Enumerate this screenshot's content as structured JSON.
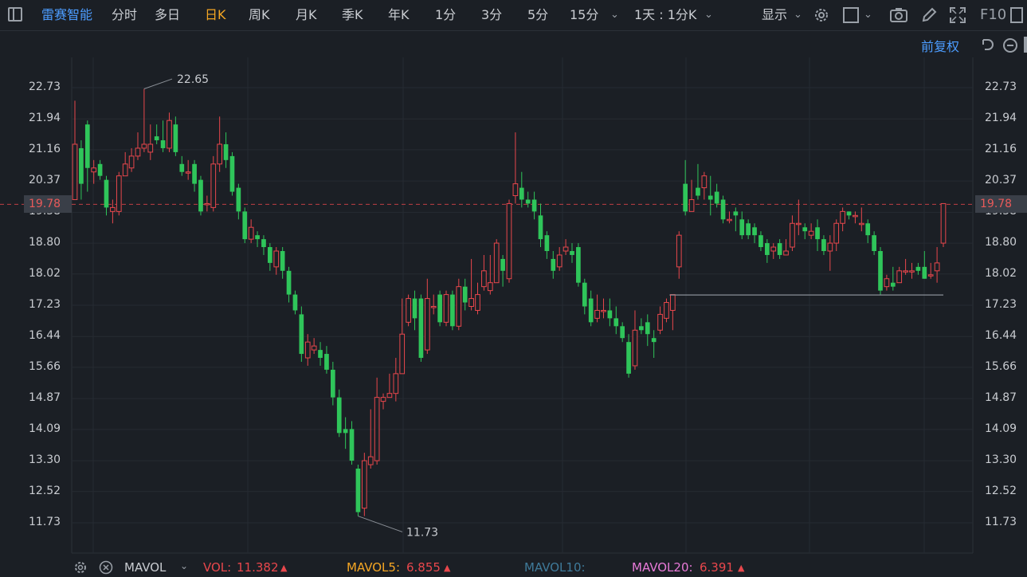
{
  "toolbar": {
    "stock_name": "雷赛智能",
    "tabs": [
      "分时",
      "多日",
      "日K",
      "周K",
      "月K",
      "季K",
      "年K",
      "1分",
      "3分",
      "5分",
      "15分"
    ],
    "active_tab": "日K",
    "period_select": "1天 : 1分K",
    "display_label": "显示",
    "f10_label": "F10"
  },
  "subbar": {
    "adjust_label": "前复权"
  },
  "axis": {
    "ticks": [
      "22.73",
      "21.94",
      "21.16",
      "20.37",
      "19.58",
      "18.80",
      "18.02",
      "17.23",
      "16.44",
      "15.66",
      "14.87",
      "14.09",
      "13.30",
      "12.52",
      "11.73"
    ],
    "current_price": "19.78"
  },
  "annotations": {
    "high_label": "22.65",
    "low_label": "11.73"
  },
  "bottom_bar": {
    "indicator": "MAVOL",
    "vol_label": "VOL:",
    "vol_value": "11.382",
    "mavol5_label": "MAVOL5:",
    "mavol5_value": "6.855",
    "mavol10_label": "MAVOL10:",
    "mavol20_label": "MAVOL20:",
    "mavol20_value": "6.391"
  },
  "colors": {
    "up": "#e8474c",
    "down": "#2fc55a",
    "accent": "#f5a623",
    "link": "#4c9cff",
    "mavol10": "#3f7a9a",
    "mavol20": "#e87ad8"
  },
  "chart_data": {
    "type": "candlestick",
    "y_ticks": [
      22.73,
      21.94,
      21.16,
      20.37,
      19.58,
      18.8,
      18.02,
      17.23,
      16.44,
      15.66,
      14.87,
      14.09,
      13.3,
      12.52,
      11.73
    ],
    "ylim": [
      11.45,
      23.05
    ],
    "current_price": 19.78,
    "high": 22.65,
    "low": 11.73,
    "candles": [
      [
        19.9,
        21.3,
        22.4,
        19.9
      ],
      [
        21.2,
        20.3,
        21.4,
        19.9
      ],
      [
        21.8,
        20.7,
        21.9,
        20.1
      ],
      [
        20.6,
        20.7,
        20.9,
        20.3
      ],
      [
        20.8,
        20.5,
        20.9,
        20.4
      ],
      [
        20.4,
        19.7,
        20.5,
        19.5
      ],
      [
        19.6,
        19.7,
        19.9,
        19.3
      ],
      [
        19.6,
        20.5,
        20.6,
        19.5
      ],
      [
        20.5,
        20.8,
        21.1,
        20.5
      ],
      [
        20.7,
        21.0,
        21.2,
        20.6
      ],
      [
        21.0,
        21.2,
        21.6,
        20.9
      ],
      [
        21.2,
        21.3,
        22.7,
        21.1
      ],
      [
        21.1,
        21.3,
        21.8,
        20.9
      ],
      [
        21.5,
        21.4,
        21.8,
        21.3
      ],
      [
        21.4,
        21.2,
        21.9,
        21.1
      ],
      [
        21.2,
        21.9,
        22.1,
        21.1
      ],
      [
        21.8,
        21.1,
        22.0,
        21.0
      ],
      [
        20.8,
        20.6,
        21.0,
        20.5
      ],
      [
        20.6,
        20.6,
        20.9,
        20.4
      ],
      [
        20.8,
        20.3,
        20.9,
        20.1
      ],
      [
        20.4,
        19.6,
        20.5,
        19.5
      ],
      [
        19.8,
        19.8,
        20.0,
        19.6
      ],
      [
        19.7,
        20.8,
        21.0,
        19.6
      ],
      [
        20.8,
        21.3,
        22.0,
        20.6
      ],
      [
        21.3,
        20.9,
        21.6,
        20.7
      ],
      [
        21.0,
        20.1,
        21.1,
        20.0
      ],
      [
        20.2,
        19.6,
        20.3,
        19.4
      ],
      [
        19.6,
        18.9,
        19.7,
        18.8
      ],
      [
        18.9,
        19.2,
        19.4,
        18.8
      ],
      [
        19.0,
        18.9,
        19.1,
        18.7
      ],
      [
        18.9,
        18.7,
        19.0,
        18.5
      ],
      [
        18.7,
        18.3,
        18.8,
        18.1
      ],
      [
        18.2,
        18.6,
        18.7,
        18.0
      ],
      [
        18.6,
        18.1,
        18.7,
        17.9
      ],
      [
        18.1,
        17.5,
        18.2,
        17.3
      ],
      [
        17.5,
        17.1,
        17.6,
        17.0
      ],
      [
        17.0,
        16.0,
        17.2,
        15.8
      ],
      [
        15.9,
        16.3,
        16.5,
        15.7
      ],
      [
        16.1,
        16.2,
        16.4,
        16.0
      ],
      [
        16.1,
        15.9,
        16.3,
        15.7
      ],
      [
        16.0,
        15.6,
        16.2,
        15.5
      ],
      [
        15.6,
        14.9,
        15.8,
        14.7
      ],
      [
        14.9,
        14.0,
        15.1,
        13.9
      ],
      [
        14.1,
        14.0,
        14.4,
        13.6
      ],
      [
        14.1,
        13.3,
        14.3,
        13.2
      ],
      [
        13.1,
        12.0,
        13.2,
        11.9
      ],
      [
        12.1,
        13.3,
        13.5,
        11.9
      ],
      [
        13.2,
        13.4,
        14.6,
        13.1
      ],
      [
        13.3,
        14.9,
        15.4,
        13.2
      ],
      [
        14.8,
        14.9,
        15.0,
        14.6
      ],
      [
        14.9,
        15.0,
        15.5,
        14.9
      ],
      [
        15.0,
        15.5,
        15.9,
        14.8
      ],
      [
        15.5,
        16.5,
        17.4,
        15.5
      ],
      [
        16.8,
        17.4,
        17.5,
        16.7
      ],
      [
        17.4,
        16.9,
        17.6,
        16.6
      ],
      [
        17.4,
        15.9,
        17.5,
        15.8
      ],
      [
        16.1,
        17.4,
        17.9,
        16.0
      ],
      [
        17.2,
        17.2,
        17.5,
        17.0
      ],
      [
        17.5,
        16.8,
        17.6,
        16.7
      ],
      [
        16.8,
        17.5,
        17.6,
        16.7
      ],
      [
        17.5,
        16.7,
        17.6,
        16.6
      ],
      [
        16.7,
        17.7,
        17.9,
        16.6
      ],
      [
        17.7,
        17.3,
        17.9,
        17.1
      ],
      [
        17.2,
        17.4,
        18.4,
        17.1
      ],
      [
        17.1,
        17.5,
        17.8,
        17.0
      ],
      [
        17.7,
        18.1,
        18.5,
        17.6
      ],
      [
        17.6,
        17.8,
        18.5,
        17.5
      ],
      [
        17.8,
        18.8,
        18.9,
        17.8
      ],
      [
        18.4,
        18.1,
        18.5,
        17.7
      ],
      [
        17.9,
        19.8,
        19.9,
        17.8
      ],
      [
        20.0,
        20.3,
        21.6,
        19.8
      ],
      [
        20.2,
        19.9,
        20.6,
        19.7
      ],
      [
        19.9,
        19.8,
        20.1,
        19.7
      ],
      [
        19.9,
        19.6,
        20.1,
        19.4
      ],
      [
        19.5,
        18.9,
        19.8,
        18.7
      ],
      [
        19.0,
        18.6,
        19.1,
        18.4
      ],
      [
        18.4,
        18.1,
        18.6,
        17.9
      ],
      [
        18.2,
        18.5,
        18.7,
        18.1
      ],
      [
        18.6,
        18.7,
        18.9,
        18.5
      ],
      [
        18.6,
        18.5,
        18.8,
        18.3
      ],
      [
        18.7,
        17.8,
        18.8,
        17.7
      ],
      [
        17.8,
        17.2,
        17.9,
        17.0
      ],
      [
        17.4,
        16.8,
        17.6,
        16.7
      ],
      [
        16.9,
        17.1,
        17.5,
        16.8
      ],
      [
        17.1,
        17.1,
        17.4,
        16.9
      ],
      [
        17.1,
        16.9,
        17.4,
        16.7
      ],
      [
        16.9,
        16.7,
        17.2,
        16.5
      ],
      [
        16.7,
        16.4,
        16.8,
        16.3
      ],
      [
        16.3,
        15.5,
        16.5,
        15.4
      ],
      [
        15.7,
        16.6,
        17.1,
        15.6
      ],
      [
        16.7,
        16.6,
        16.9,
        16.5
      ],
      [
        16.8,
        16.5,
        17.0,
        16.2
      ],
      [
        16.4,
        16.3,
        16.6,
        15.9
      ],
      [
        16.6,
        17.0,
        17.2,
        16.5
      ],
      [
        16.9,
        17.3,
        17.4,
        16.8
      ],
      [
        17.1,
        17.5,
        17.5,
        16.6
      ],
      [
        18.2,
        19.0,
        19.1,
        17.9
      ],
      [
        20.3,
        19.6,
        20.9,
        19.5
      ],
      [
        19.6,
        19.9,
        20.4,
        19.8
      ],
      [
        20.2,
        20.0,
        20.8,
        19.9
      ],
      [
        20.2,
        20.5,
        20.6,
        19.9
      ],
      [
        20.0,
        19.9,
        20.5,
        19.5
      ],
      [
        20.1,
        19.8,
        20.3,
        19.7
      ],
      [
        19.9,
        19.4,
        20.0,
        19.3
      ],
      [
        19.4,
        19.4,
        19.6,
        19.3
      ],
      [
        19.6,
        19.5,
        19.7,
        19.1
      ],
      [
        19.4,
        19.0,
        19.6,
        18.9
      ],
      [
        19.3,
        19.0,
        19.4,
        18.9
      ],
      [
        19.2,
        19.0,
        19.3,
        18.8
      ],
      [
        19.0,
        18.7,
        19.1,
        18.6
      ],
      [
        18.8,
        18.5,
        18.9,
        18.3
      ],
      [
        18.6,
        18.7,
        18.8,
        18.4
      ],
      [
        18.8,
        18.5,
        18.9,
        18.4
      ],
      [
        18.5,
        18.6,
        18.9,
        18.5
      ],
      [
        18.7,
        19.3,
        19.5,
        18.6
      ],
      [
        19.3,
        19.3,
        19.9,
        19.0
      ],
      [
        19.2,
        19.1,
        19.3,
        18.9
      ],
      [
        19.0,
        19.1,
        19.3,
        18.9
      ],
      [
        19.2,
        18.9,
        19.4,
        18.6
      ],
      [
        18.9,
        18.6,
        19.0,
        18.5
      ],
      [
        18.6,
        18.8,
        19.0,
        18.1
      ],
      [
        18.8,
        19.3,
        19.4,
        18.6
      ],
      [
        19.3,
        19.6,
        19.7,
        19.1
      ],
      [
        19.6,
        19.5,
        19.6,
        19.4
      ],
      [
        19.5,
        19.5,
        19.6,
        19.3
      ],
      [
        19.3,
        19.3,
        19.7,
        19.1
      ],
      [
        19.3,
        19.0,
        19.4,
        18.8
      ],
      [
        19.0,
        18.6,
        19.1,
        18.5
      ],
      [
        18.6,
        17.6,
        18.7,
        17.5
      ],
      [
        17.7,
        17.9,
        18.0,
        17.6
      ],
      [
        17.8,
        17.7,
        18.2,
        17.6
      ],
      [
        17.8,
        18.1,
        18.2,
        17.9
      ],
      [
        18.1,
        18.1,
        18.4,
        18.0
      ],
      [
        18.1,
        18.1,
        18.3,
        17.9
      ],
      [
        18.2,
        18.1,
        18.3,
        18.0
      ],
      [
        18.2,
        17.9,
        18.6,
        17.9
      ],
      [
        18.0,
        18.0,
        18.3,
        17.9
      ],
      [
        18.1,
        18.3,
        18.7,
        17.8
      ],
      [
        18.8,
        19.8,
        19.8,
        18.7
      ]
    ]
  }
}
